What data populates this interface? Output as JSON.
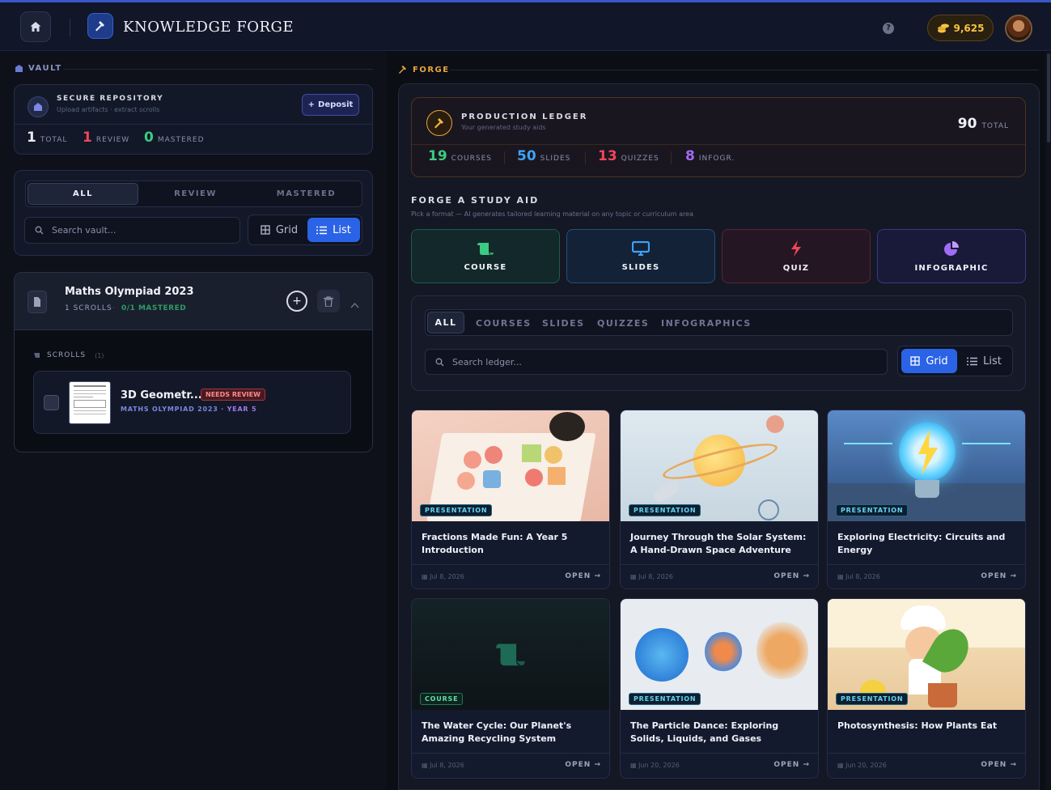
{
  "app": {
    "brand": "KNOWLEDGE FORGE",
    "coins": "9,625"
  },
  "vault": {
    "heading": "VAULT",
    "repo_title": "SECURE REPOSITORY",
    "repo_sub": "Upload artifacts · extract scrolls",
    "deposit_label": "Deposit",
    "stats": [
      {
        "value": "1",
        "label": "TOTAL",
        "color": "#e8eaf2"
      },
      {
        "value": "1",
        "label": "REVIEW",
        "color": "#f0475a"
      },
      {
        "value": "0",
        "label": "MASTERED",
        "color": "#3ccb82"
      }
    ],
    "tabs": [
      "ALL",
      "REVIEW",
      "MASTERED"
    ],
    "search_placeholder": "Search vault...",
    "view_grid": "Grid",
    "view_list": "List",
    "collection": {
      "title": "Maths Olympiad 2023",
      "scroll_count": "1 SCROLLS",
      "mastered": "0/1 MASTERED",
      "scrolls_label": "SCROLLS",
      "scrolls_count": "(1)",
      "item": {
        "title": "3D Geometr...",
        "status": "NEEDS REVIEW",
        "meta_a": "MATHS OLYMPIAD 2023",
        "meta_b": "· YEAR 5"
      }
    }
  },
  "forge": {
    "heading": "FORGE",
    "ledger_title": "PRODUCTION LEDGER",
    "ledger_sub": "Your generated study aids",
    "total_value": "90",
    "total_label": "TOTAL",
    "stats": [
      {
        "value": "19",
        "label": "COURSES",
        "color": "#3ccb82"
      },
      {
        "value": "50",
        "label": "SLIDES",
        "color": "#3fa2f5"
      },
      {
        "value": "13",
        "label": "QUIZZES",
        "color": "#f0475a"
      },
      {
        "value": "8",
        "label": "INFOGR.",
        "color": "#a06cf5"
      }
    ],
    "study_title": "FORGE A STUDY AID",
    "study_sub": "Pick a format — AI generates tailored learning material on any topic or curriculum area",
    "formats": [
      "COURSE",
      "SLIDES",
      "QUIZ",
      "INFOGRAPHIC"
    ],
    "filters": [
      "ALL",
      "COURSES",
      "SLIDES",
      "QUIZZES",
      "INFOGRAPHICS"
    ],
    "search_placeholder": "Search ledger...",
    "view_grid": "Grid",
    "view_list": "List",
    "open_label": "OPEN →",
    "cards": [
      {
        "title": "Fractions Made Fun: A Year 5 Introduction",
        "badge": "PRESENTATION",
        "date": "Jul 8, 2026"
      },
      {
        "title": "Journey Through the Solar System: A Hand-Drawn Space Adventure",
        "badge": "PRESENTATION",
        "date": "Jul 8, 2026"
      },
      {
        "title": "Exploring Electricity: Circuits and Energy",
        "badge": "PRESENTATION",
        "date": "Jul 8, 2026"
      },
      {
        "title": "The Water Cycle: Our Planet's Amazing Recycling System",
        "badge": "COURSE",
        "date": "Jul 8, 2026"
      },
      {
        "title": "The Particle Dance: Exploring Solids, Liquids, and Gases",
        "badge": "PRESENTATION",
        "date": "Jun 20, 2026"
      },
      {
        "title": "Photosynthesis: How Plants Eat",
        "badge": "PRESENTATION",
        "date": "Jun 20, 2026"
      }
    ]
  }
}
